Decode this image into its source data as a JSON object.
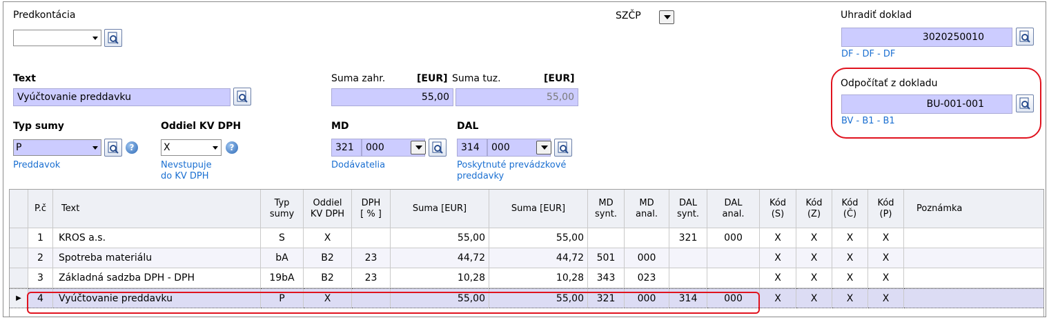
{
  "form": {
    "predkontacia_label": "Predkontácia",
    "predkontacia_value": "",
    "szcp_label": "SZČP",
    "uhradit_label": "Uhradiť doklad",
    "uhradit_value": "3020250010",
    "uhradit_link": "DF - DF - DF",
    "odpocitat_label": "Odpočítať z dokladu",
    "odpocitat_value": "BU-001-001",
    "odpocitat_link": "BV - B1 - B1",
    "text_label": "Text",
    "text_value": "Vyúčtovanie preddavku",
    "suma_zahr_label": "Suma zahr.",
    "suma_zahr_cur": "[EUR]",
    "suma_zahr_value": "55,00",
    "suma_tuz_label": "Suma tuz.",
    "suma_tuz_cur": "[EUR]",
    "suma_tuz_value": "55,00",
    "typ_sumy_label": "Typ sumy",
    "typ_sumy_value": "P",
    "typ_sumy_link": "Preddavok",
    "oddiel_label": "Oddiel KV DPH",
    "oddiel_value": "X",
    "oddiel_link1": "Nevstupuje",
    "oddiel_link2": "do KV DPH",
    "md_label": "MD",
    "md_synt": "321",
    "md_anal": "000",
    "md_link": "Dodávatelia",
    "dal_label": "DAL",
    "dal_synt": "314",
    "dal_anal": "000",
    "dal_link1": "Poskytnuté prevádzkové",
    "dal_link2": "preddavky",
    "help_glyph": "?"
  },
  "table": {
    "headers": {
      "pc": "P.č",
      "text": "Text",
      "typ1": "Typ",
      "typ2": "sumy",
      "odd1": "Oddiel",
      "odd2": "KV DPH",
      "dph1": "DPH",
      "dph2": "[ % ]",
      "suma1": "Suma [EUR]",
      "suma2": "Suma [EUR]",
      "mds1": "MD",
      "mds2": "synt.",
      "mda1": "MD",
      "mda2": "anal.",
      "dals1": "DAL",
      "dals2": "synt.",
      "dala1": "DAL",
      "dala2": "anal.",
      "ks1": "Kód",
      "ks2": "(S)",
      "kz1": "Kód",
      "kz2": "(Z)",
      "kc1": "Kód",
      "kc2": "(Č)",
      "kp1": "Kód",
      "kp2": "(P)",
      "pozn": "Poznámka"
    },
    "rows": [
      {
        "pc": "1",
        "text": "KROS a.s.",
        "typ": "S",
        "odd": "X",
        "dph": "",
        "suma1": "55,00",
        "suma2": "55,00",
        "mds": "",
        "mda": "",
        "dals": "321",
        "dala": "000",
        "ks": "X",
        "kz": "X",
        "kc": "X",
        "kp": "X",
        "pozn": ""
      },
      {
        "pc": "2",
        "text": "Spotreba materiálu",
        "typ": "bA",
        "odd": "B2",
        "dph": "23",
        "suma1": "44,72",
        "suma2": "44,72",
        "mds": "501",
        "mda": "000",
        "dals": "",
        "dala": "",
        "ks": "X",
        "kz": "X",
        "kc": "X",
        "kp": "X",
        "pozn": ""
      },
      {
        "pc": "3",
        "text": "Základná sadzba DPH - DPH",
        "typ": "19bA",
        "odd": "B2",
        "dph": "23",
        "suma1": "10,28",
        "suma2": "10,28",
        "mds": "343",
        "mda": "023",
        "dals": "",
        "dala": "",
        "ks": "X",
        "kz": "X",
        "kc": "X",
        "kp": "X",
        "pozn": ""
      },
      {
        "pc": "4",
        "text": "Vyúčtovanie preddavku",
        "typ": "P",
        "odd": "X",
        "dph": "",
        "suma1": "55,00",
        "suma2": "55,00",
        "mds": "321",
        "mda": "000",
        "dals": "314",
        "dala": "000",
        "ks": "X",
        "kz": "X",
        "kc": "X",
        "kp": "X",
        "pozn": ""
      }
    ]
  },
  "colors": {
    "field_bg": "#ccccff",
    "link": "#1a6fd1",
    "highlight": "#e0121e"
  }
}
